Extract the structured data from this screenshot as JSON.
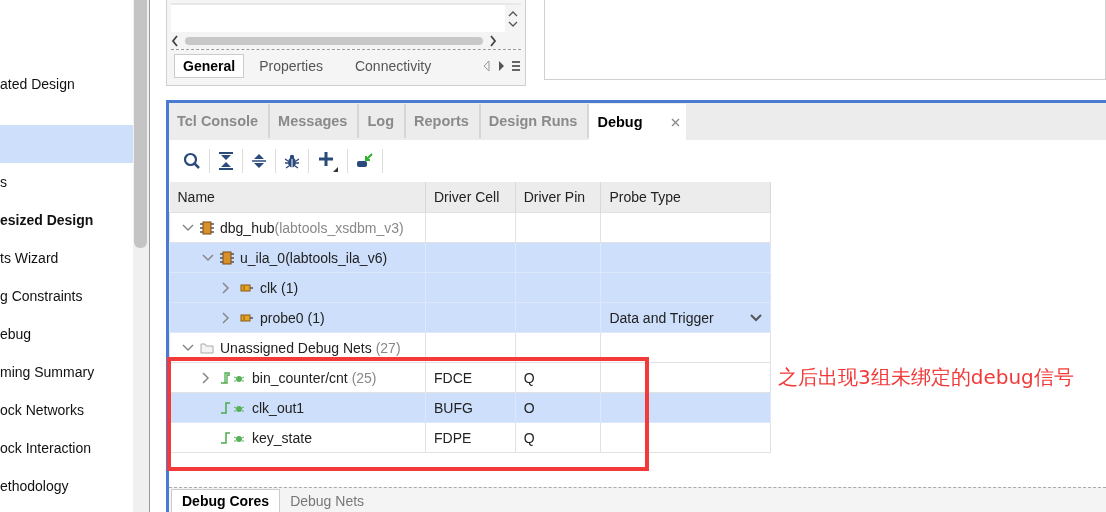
{
  "sidebar": {
    "items": [
      {
        "label": "ated Design",
        "bold": false,
        "selected": false
      },
      {
        "selected": true
      },
      {
        "label": "s",
        "bold": false,
        "selected": false
      },
      {
        "label": "esized Design",
        "bold": true,
        "selected": false
      },
      {
        "label": "ts Wizard",
        "bold": false,
        "selected": false
      },
      {
        "label": "g Constraints",
        "bold": false,
        "selected": false
      },
      {
        "label": "ebug",
        "bold": false,
        "selected": false
      },
      {
        "label": "ming Summary",
        "bold": false,
        "selected": false
      },
      {
        "label": "ock Networks",
        "bold": false,
        "selected": false
      },
      {
        "label": "ock Interaction",
        "bold": false,
        "selected": false
      },
      {
        "label": "ethodology",
        "bold": false,
        "selected": false
      }
    ]
  },
  "properties_panel": {
    "tabs": [
      {
        "label": "General",
        "selected": true
      },
      {
        "label": "Properties",
        "selected": false
      },
      {
        "label": "Connectivity",
        "selected": false
      }
    ]
  },
  "bottom_panel": {
    "tabs": [
      {
        "label": "Tcl Console",
        "selected": false
      },
      {
        "label": "Messages",
        "selected": false
      },
      {
        "label": "Log",
        "selected": false
      },
      {
        "label": "Reports",
        "selected": false
      },
      {
        "label": "Design Runs",
        "selected": false
      },
      {
        "label": "Debug",
        "selected": true,
        "closable": true
      }
    ],
    "table": {
      "columns": [
        "Name",
        "Driver Cell",
        "Driver Pin",
        "Probe Type"
      ],
      "rows": [
        {
          "kind": "core",
          "name": "dbg_hub",
          "note": "(labtools_xsdbm_v3)",
          "expanded": true,
          "selected": false,
          "children": [
            {
              "kind": "core",
              "name": "u_ila_0(labtools_ila_v6)",
              "expanded": true,
              "selected": true,
              "children": [
                {
                  "kind": "probe",
                  "name": "clk (1)",
                  "expanded": false,
                  "selected": true
                },
                {
                  "kind": "probe",
                  "name": "probe0 (1)",
                  "expanded": false,
                  "selected": true,
                  "probe_type": "Data and Trigger"
                }
              ]
            }
          ]
        },
        {
          "kind": "folder",
          "name": "Unassigned Debug Nets",
          "note": "(27)",
          "expanded": true,
          "selected": false,
          "children": [
            {
              "kind": "bus",
              "name": "bin_counter/cnt",
              "note": "(25)",
              "expanded": false,
              "selected": false,
              "driver_cell": "FDCE",
              "driver_pin": "Q"
            },
            {
              "kind": "net",
              "name": "clk_out1",
              "selected": true,
              "driver_cell": "BUFG",
              "driver_pin": "O"
            },
            {
              "kind": "net",
              "name": "key_state",
              "selected": false,
              "driver_cell": "FDPE",
              "driver_pin": "Q"
            }
          ]
        }
      ]
    },
    "bottom_tabs": [
      {
        "label": "Debug Cores",
        "selected": true
      },
      {
        "label": "Debug Nets",
        "selected": false
      }
    ]
  },
  "annotation": {
    "text": "之后出现3组未绑定的debug信号"
  }
}
